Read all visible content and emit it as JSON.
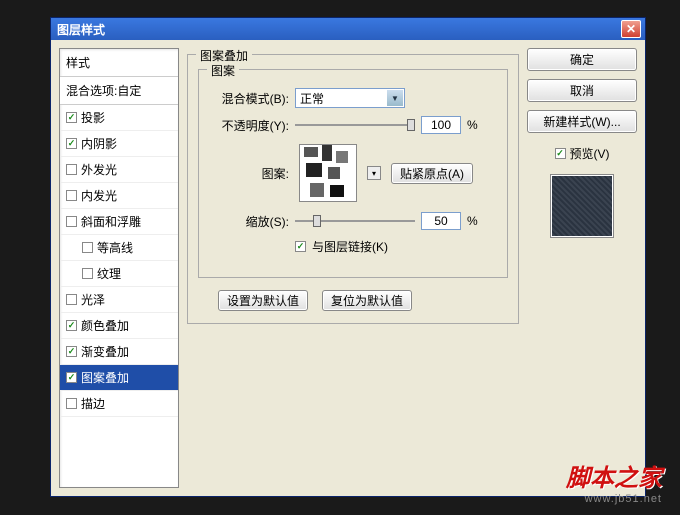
{
  "window": {
    "title": "图层样式"
  },
  "left": {
    "header": "样式",
    "subheader": "混合选项:自定",
    "items": [
      {
        "label": "投影",
        "checked": true,
        "indent": false
      },
      {
        "label": "内阴影",
        "checked": true,
        "indent": false
      },
      {
        "label": "外发光",
        "checked": false,
        "indent": false
      },
      {
        "label": "内发光",
        "checked": false,
        "indent": false
      },
      {
        "label": "斜面和浮雕",
        "checked": false,
        "indent": false
      },
      {
        "label": "等高线",
        "checked": false,
        "indent": true
      },
      {
        "label": "纹理",
        "checked": false,
        "indent": true
      },
      {
        "label": "光泽",
        "checked": false,
        "indent": false
      },
      {
        "label": "颜色叠加",
        "checked": true,
        "indent": false
      },
      {
        "label": "渐变叠加",
        "checked": true,
        "indent": false
      },
      {
        "label": "图案叠加",
        "checked": true,
        "indent": false,
        "selected": true
      },
      {
        "label": "描边",
        "checked": false,
        "indent": false
      }
    ]
  },
  "center": {
    "group_title": "图案叠加",
    "sub_title": "图案",
    "blend_label": "混合模式(B):",
    "blend_value": "正常",
    "opacity_label": "不透明度(Y):",
    "opacity_value": "100",
    "percent": "%",
    "pattern_label": "图案:",
    "snap_btn": "贴紧原点(A)",
    "scale_label": "缩放(S):",
    "scale_value": "50",
    "link_label": "与图层链接(K)",
    "link_checked": true,
    "set_default": "设置为默认值",
    "reset_default": "复位为默认值"
  },
  "right": {
    "ok": "确定",
    "cancel": "取消",
    "new_style": "新建样式(W)...",
    "preview_label": "预览(V)",
    "preview_checked": true
  },
  "watermark": {
    "line1": "脚本之家",
    "line2": "www.jb51.net"
  }
}
